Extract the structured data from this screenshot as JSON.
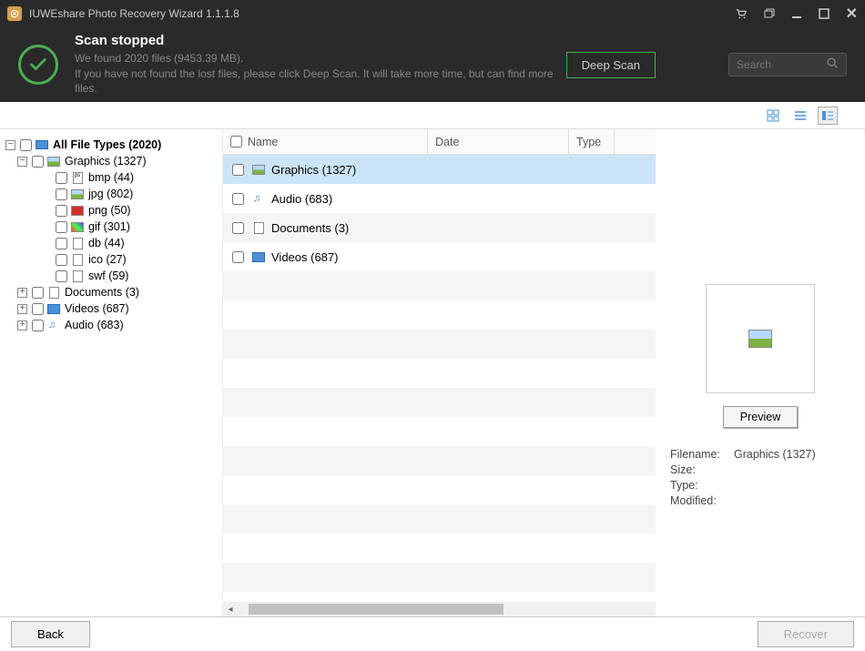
{
  "titlebar": {
    "title": "IUWEshare Photo Recovery Wizard 1.1.1.8"
  },
  "header": {
    "status_title": "Scan stopped",
    "status_line1": "We found 2020 files (9453.39 MB).",
    "status_line2": "If you have not found the lost files, please click Deep Scan. It will take more time, but can find more files.",
    "deep_scan_label": "Deep Scan",
    "search_placeholder": "Search"
  },
  "tree": {
    "root": {
      "label": "All File Types (2020)"
    },
    "graphics": {
      "label": "Graphics (1327)"
    },
    "bmp": {
      "label": "bmp (44)"
    },
    "jpg": {
      "label": "jpg (802)"
    },
    "png": {
      "label": "png (50)"
    },
    "gif": {
      "label": "gif (301)"
    },
    "db": {
      "label": "db (44)"
    },
    "ico": {
      "label": "ico (27)"
    },
    "swf": {
      "label": "swf (59)"
    },
    "documents": {
      "label": "Documents (3)"
    },
    "videos": {
      "label": "Videos (687)"
    },
    "audio": {
      "label": "Audio (683)"
    }
  },
  "list": {
    "col_name": "Name",
    "col_date": "Date",
    "col_type": "Type",
    "rows": {
      "0": {
        "label": "Graphics (1327)"
      },
      "1": {
        "label": "Audio (683)"
      },
      "2": {
        "label": "Documents (3)"
      },
      "3": {
        "label": "Videos (687)"
      }
    }
  },
  "preview": {
    "button_label": "Preview",
    "filename_label": "Filename:",
    "filename_value": "Graphics (1327)",
    "size_label": "Size:",
    "type_label": "Type:",
    "modified_label": "Modified:"
  },
  "footer": {
    "back_label": "Back",
    "recover_label": "Recover"
  }
}
